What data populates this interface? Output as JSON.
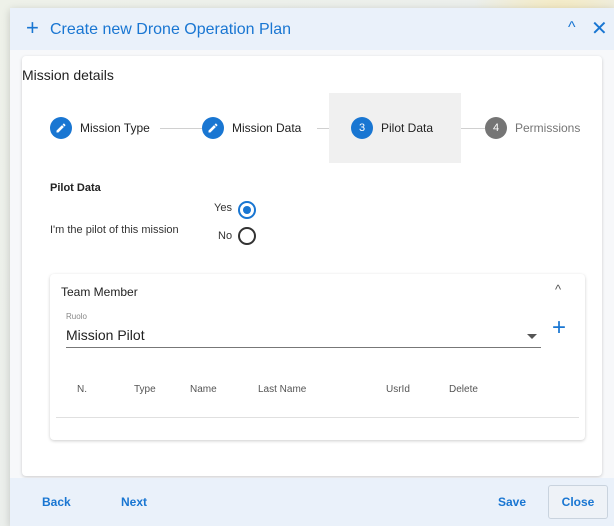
{
  "dialog": {
    "title": "Create new Drone Operation Plan",
    "accent": "#1976d2"
  },
  "card": {
    "title": "Mission details"
  },
  "stepper": {
    "steps": [
      {
        "label": "Mission Type",
        "state": "done",
        "icon": "pencil-icon"
      },
      {
        "label": "Mission Data",
        "state": "done",
        "icon": "pencil-icon"
      },
      {
        "label": "Pilot Data",
        "state": "active",
        "number": "3"
      },
      {
        "label": "Permissions",
        "state": "pending",
        "number": "4"
      }
    ]
  },
  "pilot": {
    "section_label": "Pilot Data",
    "question": "I'm the pilot of this mission",
    "yes_label": "Yes",
    "no_label": "No",
    "selected": "Yes"
  },
  "team": {
    "title": "Team Member",
    "ruolo_label": "Ruolo",
    "ruolo_value": "Mission Pilot",
    "columns": [
      "N.",
      "Type",
      "Name",
      "Last Name",
      "UsrId",
      "Delete"
    ]
  },
  "footer": {
    "back": "Back",
    "next": "Next",
    "save": "Save",
    "close": "Close"
  }
}
